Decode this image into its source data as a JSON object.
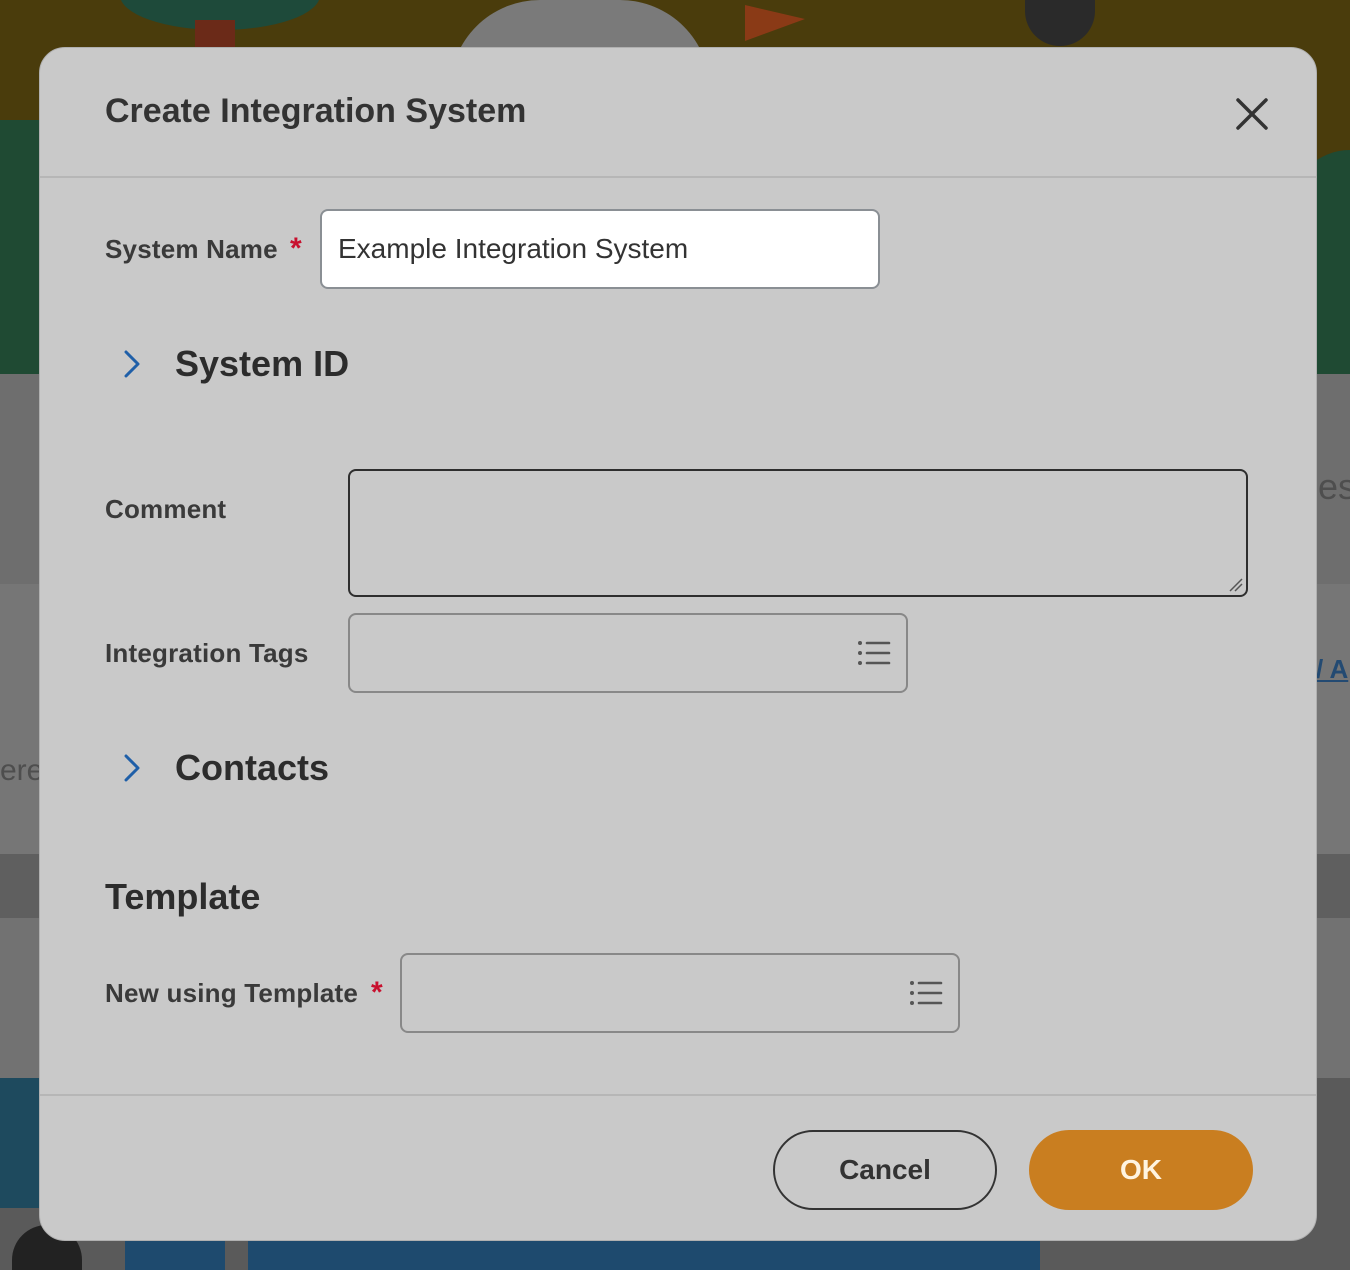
{
  "background": {
    "right_text_fragment": "es",
    "left_text_fragment": "ere",
    "right_link_fragment": "/ A"
  },
  "modal": {
    "title": "Create Integration System",
    "close_icon": "close-icon"
  },
  "form": {
    "system_name": {
      "label": "System Name",
      "required_mark": "*",
      "value": "Example Integration System"
    },
    "system_id_section": {
      "title": "System ID",
      "icon": "chevron-right-icon"
    },
    "comment": {
      "label": "Comment",
      "value": ""
    },
    "integration_tags": {
      "label": "Integration Tags",
      "icon": "list-icon"
    },
    "contacts_section": {
      "title": "Contacts",
      "icon": "chevron-right-icon"
    },
    "template": {
      "heading": "Template",
      "new_using_template": {
        "label": "New using Template",
        "required_mark": "*",
        "icon": "list-icon"
      }
    }
  },
  "footer": {
    "cancel_label": "Cancel",
    "ok_label": "OK"
  },
  "colors": {
    "accent_ok": "#c97e20",
    "required": "#c8102e",
    "chevron": "#1f5fa8"
  }
}
